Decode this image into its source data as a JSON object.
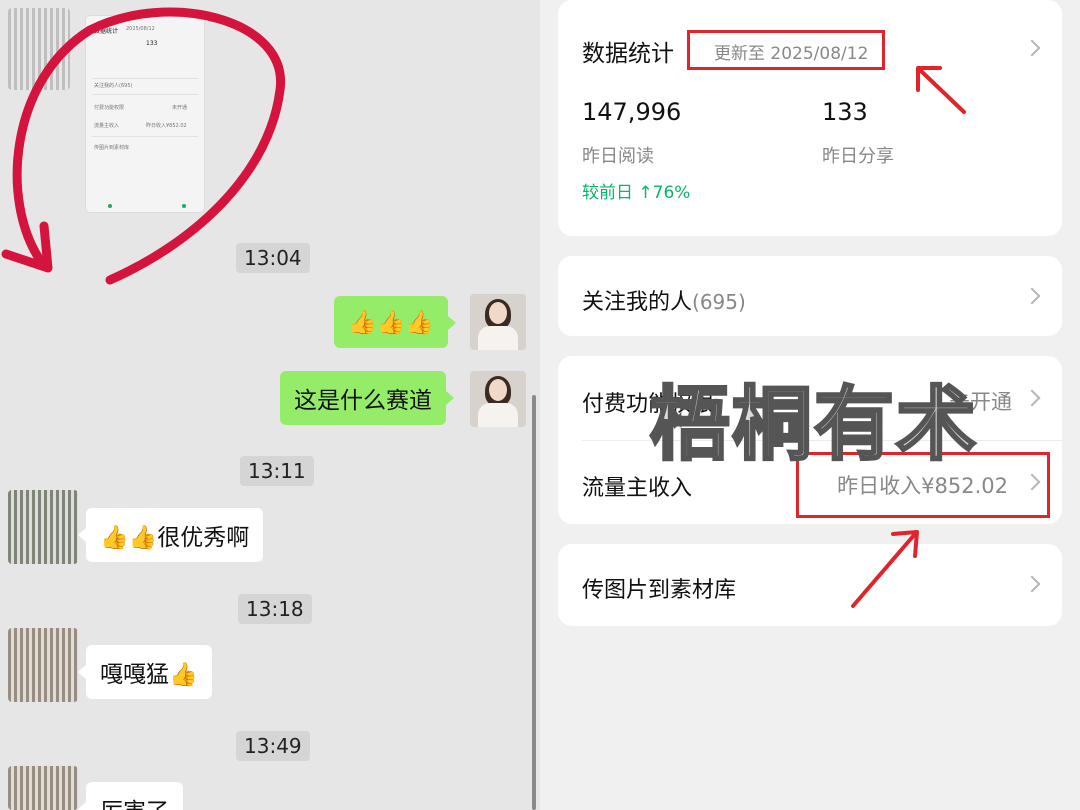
{
  "chat": {
    "thumbnail": {
      "title": "数据统计",
      "date": "2025/08/12",
      "value": "133",
      "row1": "关注我的人(695)",
      "row2": "付费功能权限",
      "row2_value": "未开通",
      "row3": "流量主收入",
      "row3_value": "昨日收入¥852.02",
      "row4": "传图片到素材库"
    },
    "messages": [
      {
        "type": "time",
        "text": "13:04"
      },
      {
        "type": "me",
        "text": "👍👍👍"
      },
      {
        "type": "me",
        "text": "这是什么赛道"
      },
      {
        "type": "time",
        "text": "13:11"
      },
      {
        "type": "other",
        "text": "👍👍很优秀啊"
      },
      {
        "type": "time",
        "text": "13:18"
      },
      {
        "type": "other",
        "text": "嘎嘎猛👍"
      },
      {
        "type": "time",
        "text": "13:49"
      },
      {
        "type": "other",
        "text": "厉害了"
      }
    ]
  },
  "stats": {
    "title": "数据统计",
    "updated": "更新至 2025/08/12",
    "reads_value": "147,996",
    "reads_label": "昨日阅读",
    "reads_delta": "较前日 ↑76%",
    "shares_value": "133",
    "shares_label": "昨日分享"
  },
  "rows": {
    "followers_label": "关注我的人",
    "followers_count": "(695)",
    "paid_label": "付费功能权限",
    "paid_value": "未开通",
    "traffic_label": "流量主收入",
    "traffic_value": "昨日收入¥852.02",
    "upload_label": "传图片到素材库"
  },
  "watermark": "梧桐有术",
  "colors": {
    "my_bubble": "#95ec69",
    "other_bubble": "#ffffff",
    "highlight_red": "#e0242b",
    "positive_green": "#07b56b"
  }
}
